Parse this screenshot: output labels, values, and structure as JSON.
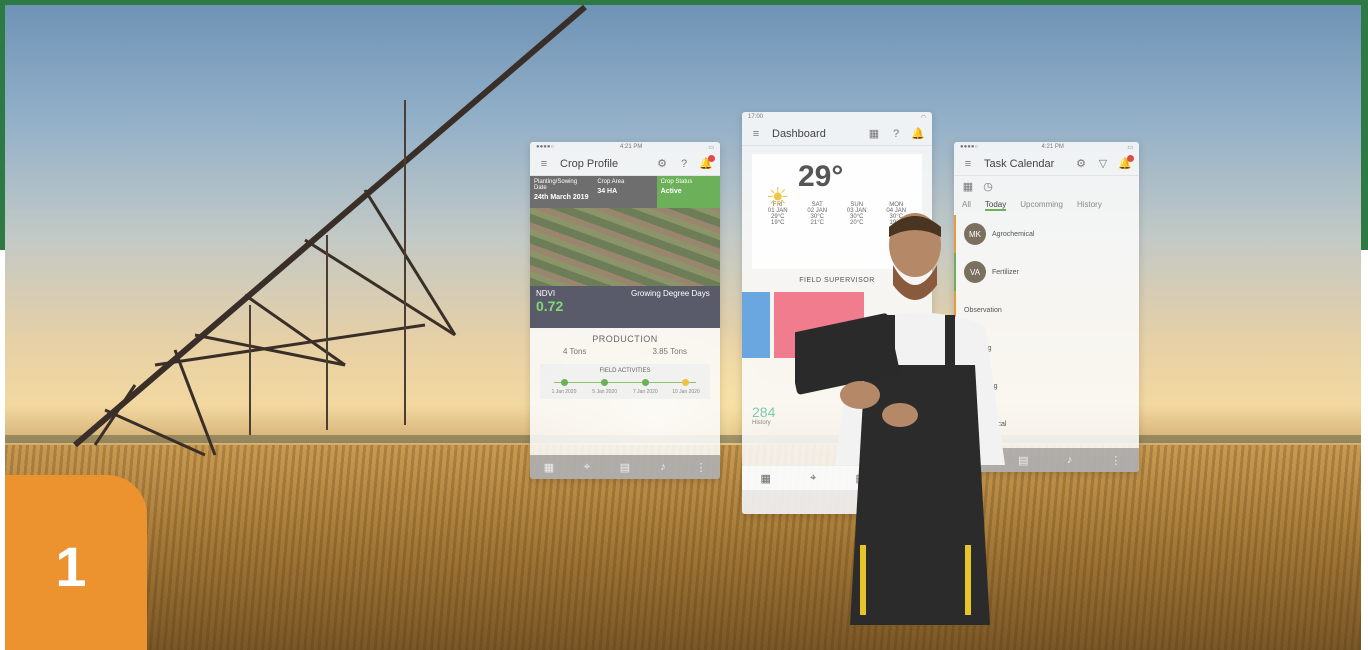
{
  "badge": {
    "number": "1"
  },
  "crop_profile": {
    "status_time": "4:21 PM",
    "title": "Crop Profile",
    "info": [
      {
        "label": "Planting/Sowing Date",
        "value": "24th March 2019"
      },
      {
        "label": "Crop Area",
        "value": "34 HA"
      },
      {
        "label": "Crop Status",
        "value": "Active"
      }
    ],
    "ndvi_label": "NDVI",
    "ndvi_value": "0.72",
    "gdd_label": "Growing Degree Days",
    "production_title": "PRODUCTION",
    "production": [
      "4 Tons",
      "3.85 Tons"
    ],
    "field_activities_title": "FIELD ACTIVITIES",
    "activities": [
      {
        "date": "1 Jan 2020"
      },
      {
        "date": "5 Jan 2020"
      },
      {
        "date": "7 Jan 2020"
      },
      {
        "date": "10 Jan 2020"
      }
    ]
  },
  "dashboard": {
    "status_time": "17:00",
    "title": "Dashboard",
    "temperature": "29°",
    "forecast": [
      {
        "day": "FRI",
        "date": "01 JAN",
        "hi": "29°C",
        "lo": "19°C"
      },
      {
        "day": "SAT",
        "date": "02 JAN",
        "hi": "30°C",
        "lo": "21°C"
      },
      {
        "day": "SUN",
        "date": "03 JAN",
        "hi": "30°C",
        "lo": "20°C"
      },
      {
        "day": "MON",
        "date": "04 JAN",
        "hi": "30°C",
        "lo": "19°C"
      }
    ],
    "field_supervisor": "FIELD SUPERVISOR",
    "history_value": "284",
    "history_label": "History"
  },
  "task_calendar": {
    "status_time": "4:21 PM",
    "title": "Task Calendar",
    "tabs": [
      "All",
      "Today",
      "Upcomming",
      "History"
    ],
    "tasks": [
      {
        "initials": "MK",
        "title": "Agrochemical"
      },
      {
        "initials": "VA",
        "title": "Fertilizer"
      },
      {
        "initials": "",
        "title": "Observation"
      },
      {
        "initials": "",
        "title": "Weeding"
      },
      {
        "initials": "",
        "title": "Harvesting"
      },
      {
        "initials": "",
        "title": "Agrochemical"
      }
    ]
  },
  "colors": {
    "frame_green": "#2d7a45",
    "badge_orange": "#ec9330",
    "accent_green": "#6cb05a"
  }
}
